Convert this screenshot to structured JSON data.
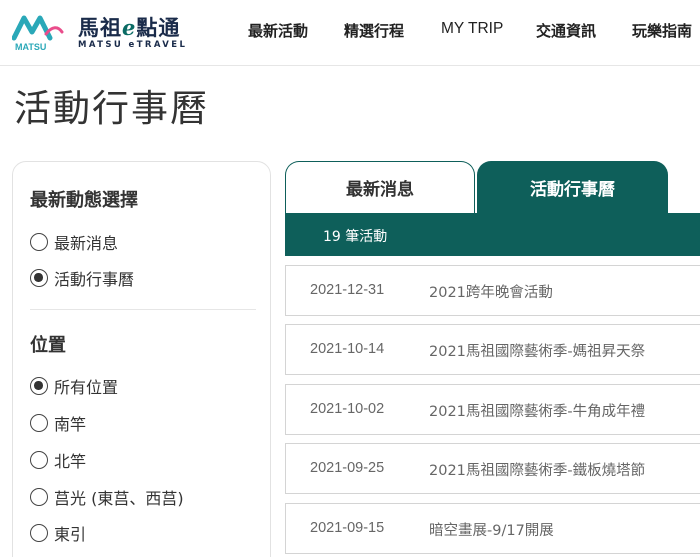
{
  "brand": {
    "title_a": "馬祖",
    "title_e": "e",
    "title_b": "點通",
    "subtitle": "MATSU eTRAVEL",
    "mark_text": "MATSU",
    "colors": {
      "teal": "#0e5f5a",
      "navy": "#1a2b4a",
      "wave": "#2aa8b8"
    }
  },
  "nav": {
    "items": [
      "最新活動",
      "精選行程",
      "MY TRIP",
      "交通資訊",
      "玩樂指南"
    ]
  },
  "page": {
    "title": "活動行事曆"
  },
  "sidebar": {
    "category_heading": "最新動態選擇",
    "categories": [
      {
        "label": "最新消息",
        "checked": false
      },
      {
        "label": "活動行事曆",
        "checked": true
      }
    ],
    "location_heading": "位置",
    "locations": [
      {
        "label": "所有位置",
        "checked": true
      },
      {
        "label": "南竿",
        "checked": false
      },
      {
        "label": "北竿",
        "checked": false
      },
      {
        "label": "莒光 (東莒、西莒)",
        "checked": false
      },
      {
        "label": "東引",
        "checked": false
      }
    ]
  },
  "tabs": [
    {
      "label": "最新消息",
      "active": false
    },
    {
      "label": "活動行事曆",
      "active": true
    }
  ],
  "results": {
    "count_label": "19 筆活動"
  },
  "events": [
    {
      "date": "2021-12-31",
      "title": "2021跨年晚會活動"
    },
    {
      "date": "2021-10-14",
      "title": "2021馬祖國際藝術季-媽祖昇天祭"
    },
    {
      "date": "2021-10-02",
      "title": "2021馬祖國際藝術季-牛角成年禮"
    },
    {
      "date": "2021-09-25",
      "title": "2021馬祖國際藝術季-鐵板燒塔節"
    },
    {
      "date": "2021-09-15",
      "title": "暗空畫展-9/17開展"
    }
  ]
}
